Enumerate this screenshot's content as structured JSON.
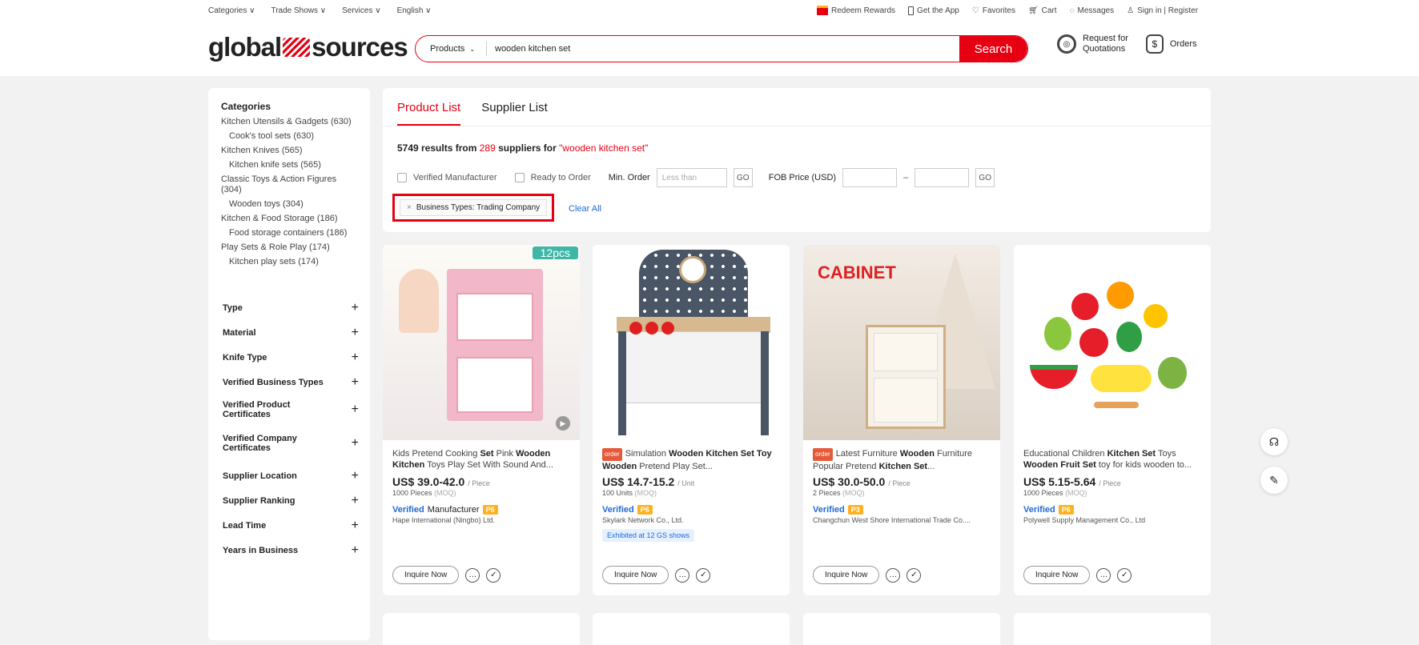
{
  "topbar": {
    "left": [
      "Categories ∨",
      "Trade Shows ∨",
      "Services ∨",
      "English ∨"
    ],
    "right": [
      "Redeem Rewards",
      "Get the App",
      "Favorites",
      "Cart",
      "Messages",
      "Sign in | Register"
    ]
  },
  "header": {
    "logo_left": "global",
    "logo_right": "sources",
    "search_category": "Products",
    "search_value": "wooden kitchen set",
    "search_button": "Search",
    "rfq_line1": "Request for",
    "rfq_line2": "Quotations",
    "orders": "Orders"
  },
  "sidebar": {
    "title": "Categories",
    "categories": [
      {
        "label": "Kitchen Utensils & Gadgets (630)",
        "sub": false
      },
      {
        "label": "Cook's tool sets (630)",
        "sub": true
      },
      {
        "label": "Kitchen Knives (565)",
        "sub": false
      },
      {
        "label": "Kitchen knife sets (565)",
        "sub": true
      },
      {
        "label": "Classic Toys & Action Figures (304)",
        "sub": false
      },
      {
        "label": "Wooden toys (304)",
        "sub": true
      },
      {
        "label": "Kitchen & Food Storage (186)",
        "sub": false
      },
      {
        "label": "Food storage containers (186)",
        "sub": true
      },
      {
        "label": "Play Sets & Role Play (174)",
        "sub": false
      },
      {
        "label": "Kitchen play sets (174)",
        "sub": true
      }
    ],
    "filters": [
      "Type",
      "Material",
      "Knife Type",
      "Verified Business Types",
      "Verified Product Certificates",
      "Verified Company Certificates",
      "Supplier Location",
      "Supplier Ranking",
      "Lead Time",
      "Years in Business"
    ]
  },
  "main": {
    "tab_products": "Product List",
    "tab_suppliers": "Supplier List",
    "results_pre": "5749 results from ",
    "results_suppliers": "289",
    "results_mid": " suppliers for ",
    "results_query": "\"wooden kitchen set\"",
    "verified_manufacturer": "Verified Manufacturer",
    "ready_to_order": "Ready to Order",
    "min_order": "Min. Order",
    "less_than": "Less than",
    "go": "GO",
    "fob": "FOB Price (USD)",
    "dash": "–",
    "chip": "Business Types: Trading Company",
    "clear_all": "Clear All"
  },
  "products": [
    {
      "title_pre": "Kids Pretend Cooking ",
      "title_b1": "Set",
      "title_mid": " Pink ",
      "title_b2": "Wooden Kitchen",
      "title_post": " Toys Play Set With Sound And...",
      "order": "",
      "price": "US$ 39.0-42.0",
      "unit": "/ Piece",
      "moq": "1000 Pieces",
      "verified": "Verified",
      "verified_extra": "Manufacturer",
      "badge": "P6",
      "supplier": "Hape International (Ningbo) Ltd.",
      "exhibit": "",
      "img_text": "12pcs"
    },
    {
      "title_pre": "Simulation ",
      "title_b1": "Wooden Kitchen",
      "title_mid": "",
      "title_b2": "Set Toy Wooden",
      "title_post": " Pretend Play Set...",
      "order": "order",
      "price": "US$ 14.7-15.2",
      "unit": "/ Unit",
      "moq": "100 Units",
      "verified": "Verified",
      "verified_extra": "",
      "badge": "P6",
      "supplier": "Skylark Network Co., Ltd.",
      "exhibit": "Exhibited at 12 GS shows",
      "img_text": ""
    },
    {
      "title_pre": "Latest Furniture ",
      "title_b1": "Wooden",
      "title_mid": " Furniture Popular Pretend ",
      "title_b2": "Kitchen Set",
      "title_post": "...",
      "order": "order",
      "price": "US$ 30.0-50.0",
      "unit": "/ Piece",
      "moq": "2 Pieces",
      "verified": "Verified",
      "verified_extra": "",
      "badge": "P3",
      "supplier": "Changchun West Shore International Trade Co....",
      "exhibit": "",
      "img_text": "CABINET"
    },
    {
      "title_pre": "Educational Children ",
      "title_b1": "Kitchen Set",
      "title_mid": " Toys ",
      "title_b2": "Wooden Fruit Set",
      "title_post": " toy for kids wooden to...",
      "order": "",
      "price": "US$ 5.15-5.64",
      "unit": "/ Piece",
      "moq": "1000 Pieces",
      "verified": "Verified",
      "verified_extra": "",
      "badge": "P6",
      "supplier": "Polywell Supply Management Co., Ltd",
      "exhibit": "",
      "img_text": ""
    }
  ],
  "card_common": {
    "inquire": "Inquire Now",
    "moq_suffix": "(MOQ)"
  }
}
